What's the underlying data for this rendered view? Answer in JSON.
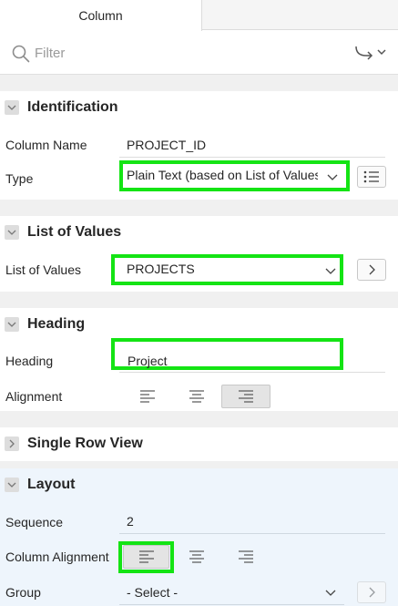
{
  "tabs": [
    {
      "label": "Column"
    }
  ],
  "filter": {
    "placeholder": "Filter"
  },
  "sections": {
    "identification": {
      "title": "Identification",
      "column_name_label": "Column Name",
      "column_name_value": "PROJECT_ID",
      "type_label": "Type",
      "type_value": "Plain Text (based on List of Values)"
    },
    "list_of_values": {
      "title": "List of Values",
      "lov_label": "List of Values",
      "lov_value": "PROJECTS"
    },
    "heading": {
      "title": "Heading",
      "heading_label": "Heading",
      "heading_value": "Project",
      "alignment_label": "Alignment",
      "alignment_selected": "right"
    },
    "single_row_view": {
      "title": "Single Row View"
    },
    "layout": {
      "title": "Layout",
      "sequence_label": "Sequence",
      "sequence_value": "2",
      "column_alignment_label": "Column Alignment",
      "column_alignment_selected": "left",
      "group_label": "Group",
      "group_value": "- Select -"
    }
  },
  "colors": {
    "highlight": "#14e414",
    "layout_bg": "#eef5fc"
  }
}
